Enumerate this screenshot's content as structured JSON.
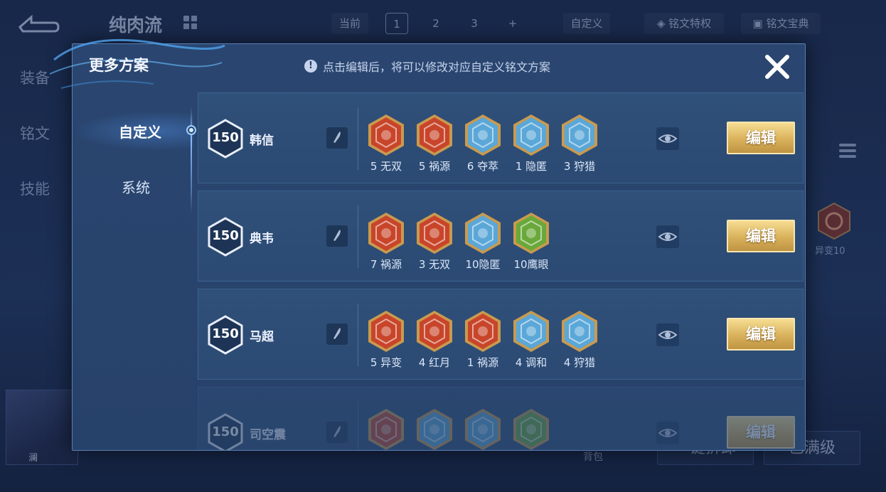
{
  "background": {
    "page_title": "纯肉流",
    "tabs": {
      "current": "当前",
      "slot1": "1",
      "slot2": "2",
      "slot3": "3",
      "add": "+"
    },
    "custom_btn": "自定义",
    "privilege_btn": "铭文特权",
    "guide_btn": "铭文宝典",
    "left_nav": [
      "装备",
      "铭文",
      "技能"
    ],
    "right_rune_label": "异变10",
    "portrait_name": "澜",
    "bottom_small": "背包",
    "bottom_btn1": "一键拆卸",
    "bottom_btn2": "已满级"
  },
  "modal": {
    "title": "更多方案",
    "hint": "点击编辑后，将可以修改对应自定义铭文方案",
    "tabs": [
      "自定义",
      "系统"
    ]
  },
  "schemes": [
    {
      "level": "150",
      "hero": "韩信",
      "edit_label": "编辑",
      "runes": [
        {
          "label": "5 无双",
          "icon": "wushuang-rune-icon",
          "color": "#c8452a"
        },
        {
          "label": "5 祸源",
          "icon": "huoyuan-rune-icon",
          "color": "#c8452a"
        },
        {
          "label": "6 夺萃",
          "icon": "duocui-rune-icon",
          "color": "#5aa7d8"
        },
        {
          "label": "1 隐匿",
          "icon": "yinni-rune-icon",
          "color": "#5aa7d8"
        },
        {
          "label": "3 狩猎",
          "icon": "shoulie-rune-icon",
          "color": "#5aa7d8"
        }
      ]
    },
    {
      "level": "150",
      "hero": "典韦",
      "edit_label": "编辑",
      "runes": [
        {
          "label": "7 祸源",
          "icon": "huoyuan-rune-icon",
          "color": "#c8452a"
        },
        {
          "label": "3 无双",
          "icon": "wushuang-rune-icon",
          "color": "#c8452a"
        },
        {
          "label": "10隐匿",
          "icon": "yinni-rune-icon",
          "color": "#5aa7d8"
        },
        {
          "label": "10鹰眼",
          "icon": "yingyan-rune-icon",
          "color": "#69a83a"
        }
      ]
    },
    {
      "level": "150",
      "hero": "马超",
      "edit_label": "编辑",
      "runes": [
        {
          "label": "5 异变",
          "icon": "yibian-rune-icon",
          "color": "#c8452a"
        },
        {
          "label": "4 红月",
          "icon": "hongyue-rune-icon",
          "color": "#c8452a"
        },
        {
          "label": "1 祸源",
          "icon": "huoyuan-rune-icon",
          "color": "#c8452a"
        },
        {
          "label": "4 调和",
          "icon": "tiaohe-rune-icon",
          "color": "#5aa7d8"
        },
        {
          "label": "4 狩猎",
          "icon": "shoulie-rune-icon",
          "color": "#5aa7d8"
        }
      ]
    },
    {
      "level": "150",
      "hero": "司空震",
      "edit_label": "编辑",
      "runes": [
        {
          "label": "",
          "icon": "red-rune-icon",
          "color": "#c8452a"
        },
        {
          "label": "",
          "icon": "blue-rune-icon",
          "color": "#5aa7d8"
        },
        {
          "label": "",
          "icon": "blue-rune-icon",
          "color": "#5aa7d8"
        },
        {
          "label": "",
          "icon": "green-rune-icon",
          "color": "#69a83a"
        }
      ]
    }
  ]
}
